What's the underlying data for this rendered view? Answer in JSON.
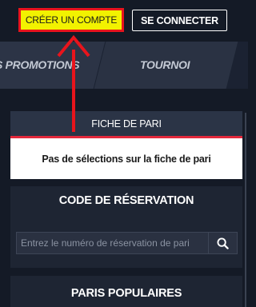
{
  "header": {
    "register_label": "CRÉER UN COMPTE",
    "login_label": "SE CONNECTER"
  },
  "nav": {
    "tabs": [
      {
        "label": "S PROMOTIONS"
      },
      {
        "label": "TOURNOI"
      }
    ]
  },
  "betslip": {
    "title": "FICHE DE PARI",
    "empty_message": "Pas de sélections sur la fiche de pari"
  },
  "reservation": {
    "title": "CODE DE RÉSERVATION",
    "input_placeholder": "Entrez le numéro de réservation de pari",
    "search_icon": "search-icon"
  },
  "popular": {
    "title": "PARIS POPULAIRES"
  },
  "colors": {
    "background": "#141a26",
    "register_bg": "#f2f200",
    "highlight_red": "#e8141c",
    "betslip_accent": "#e3283c"
  }
}
